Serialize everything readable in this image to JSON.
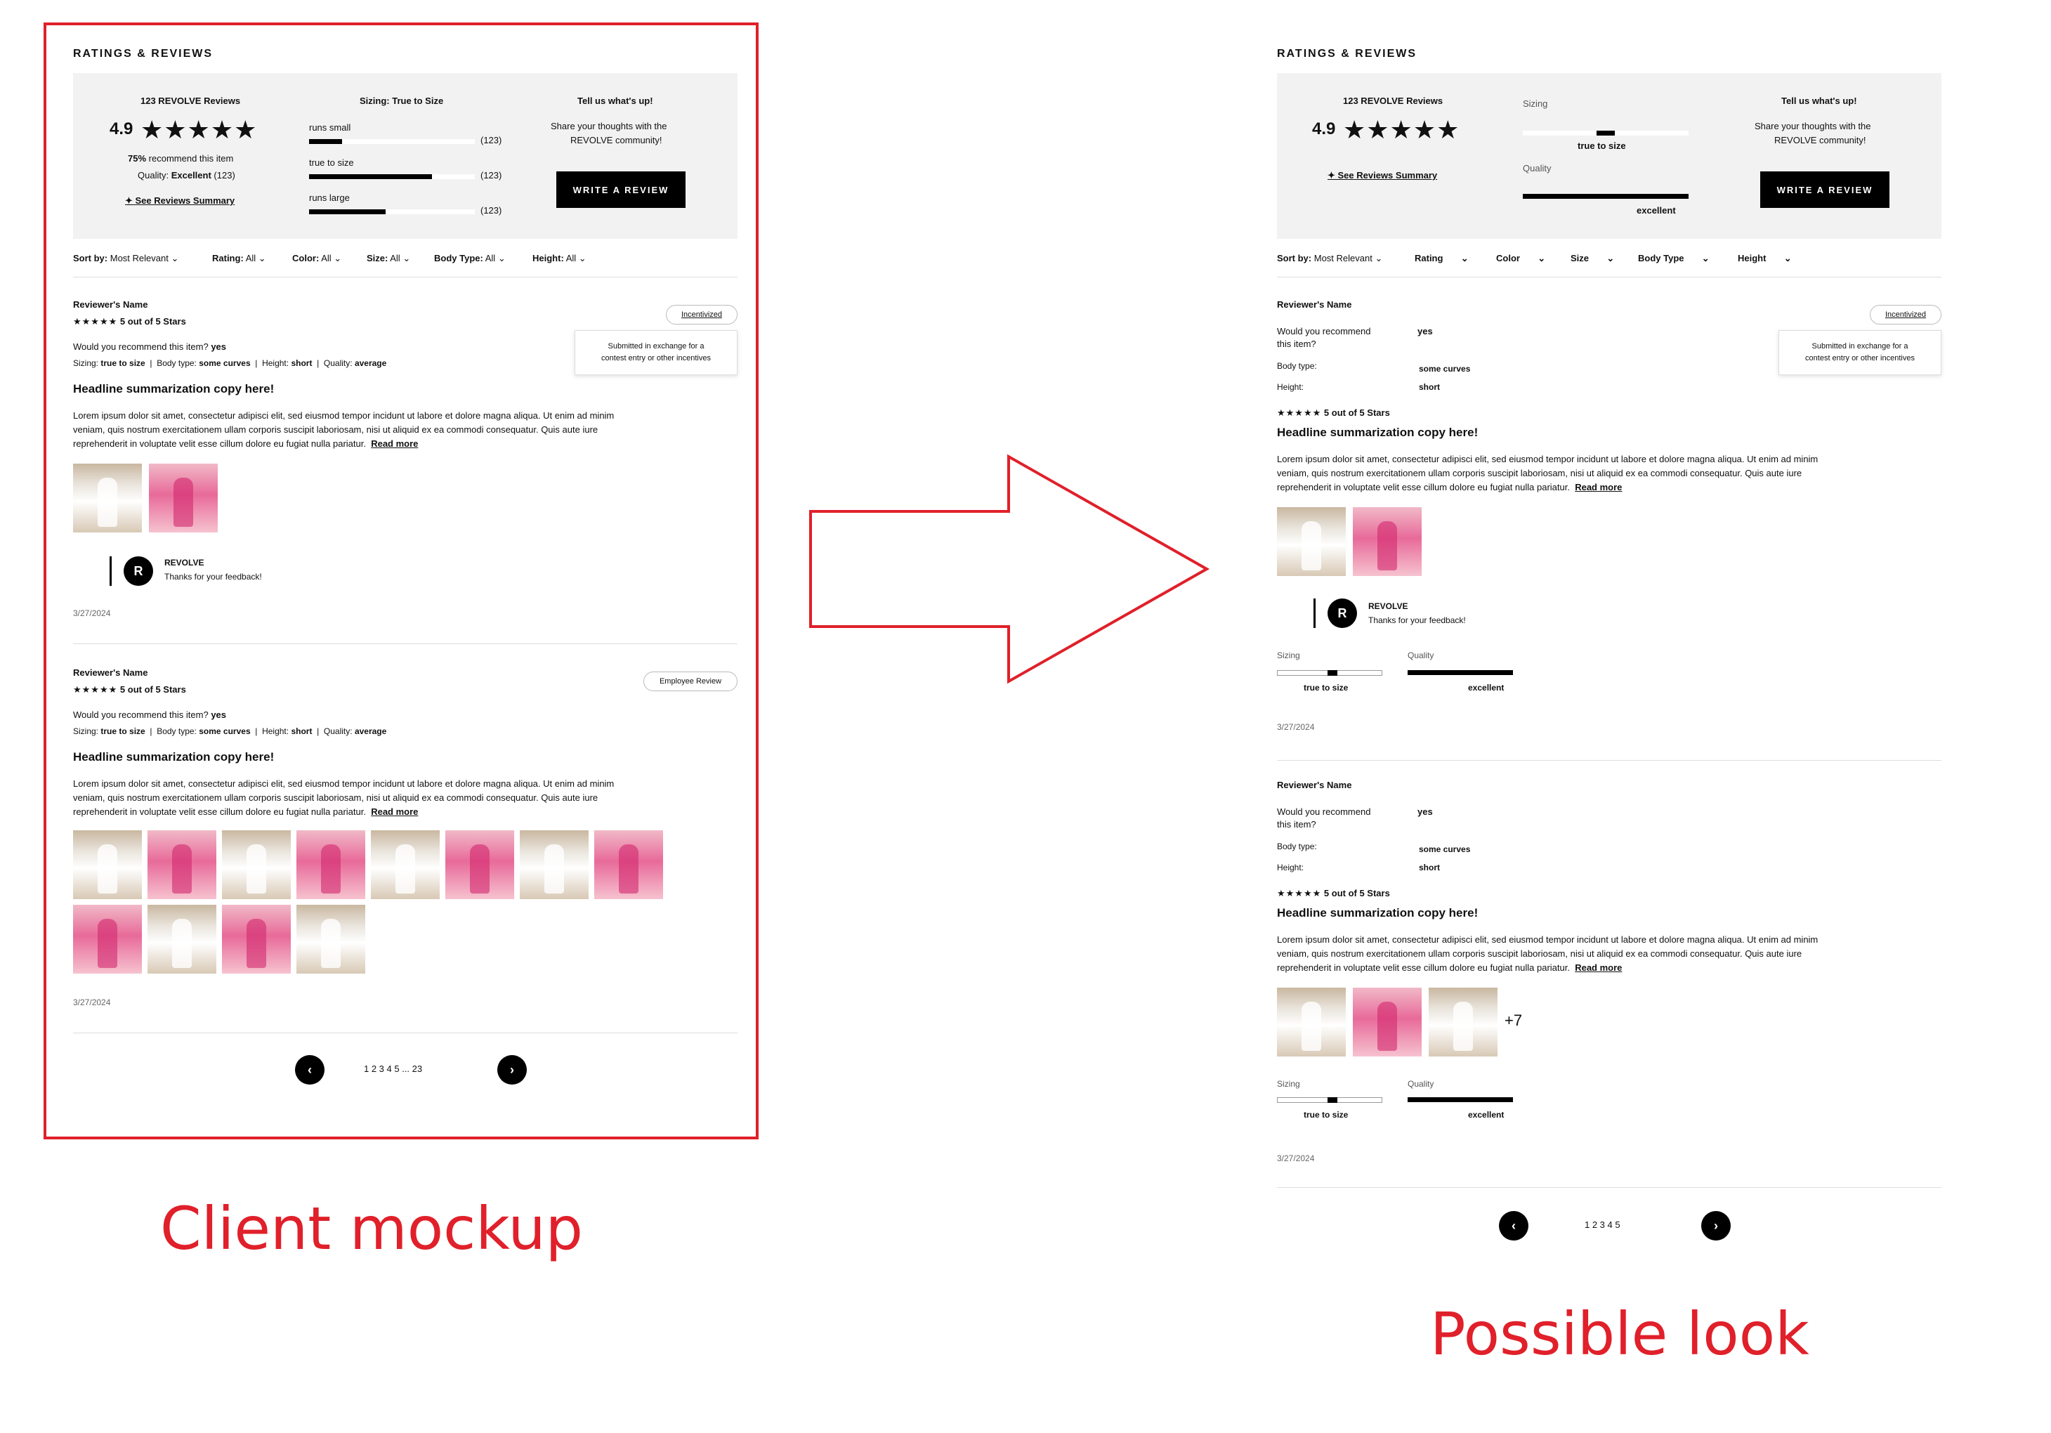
{
  "captions": {
    "left": "Client mockup",
    "right": "Possible look"
  },
  "colors": {
    "accent": "#e0202a",
    "summary_bg": "#f2f2f2",
    "button": "#000000"
  },
  "left": {
    "title": "RATINGS & REVIEWS",
    "summary": {
      "reviews_count": "123 REVOLVE Reviews",
      "rating": "4.9",
      "stars": "★★★★★",
      "recommend_pct": "75%",
      "recommend_text": "recommend this item",
      "quality_label": "Quality:",
      "quality_value": "Excellent",
      "quality_count": "(123)",
      "see_summary": "See Reviews Summary",
      "sizing_title": "Sizing: True to Size",
      "sizing_rows": [
        {
          "label": "runs small",
          "count": "(123)",
          "fill": 0.2
        },
        {
          "label": "true to size",
          "count": "(123)",
          "fill": 0.74
        },
        {
          "label": "runs large",
          "count": "(123)",
          "fill": 0.46
        }
      ],
      "cta_title": "Tell us what's up!",
      "cta_line1": "Share your thoughts with the",
      "cta_line2": "REVOLVE community!",
      "cta_button": "WRITE A REVIEW"
    },
    "filters": {
      "sort_label": "Sort by:",
      "sort_value": "Most Relevant",
      "rating_label": "Rating:",
      "rating_value": "All",
      "color_label": "Color:",
      "color_value": "All",
      "size_label": "Size:",
      "size_value": "All",
      "body_label": "Body Type:",
      "body_value": "All",
      "height_label": "Height:",
      "height_value": "All"
    },
    "reviews": [
      {
        "name": "Reviewer's Name",
        "stars": "★★★★★",
        "stars_text": "5 out of 5 Stars",
        "badge": "Incentivized",
        "tooltip_line1": "Submitted in exchange for a",
        "tooltip_line2": "contest entry or other incentives",
        "recommend_q": "Would you recommend this item?",
        "recommend_a": "yes",
        "sizing_label": "Sizing:",
        "sizing_value": "true to size",
        "body_label": "Body type:",
        "body_value": "some curves",
        "height_label": "Height:",
        "height_value": "short",
        "quality_label": "Quality:",
        "quality_value": "average",
        "headline": "Headline summarization copy here!",
        "body_l1": "Lorem ipsum dolor sit amet, consectetur adipisci elit, sed eiusmod tempor incidunt ut labore et dolore magna aliqua. Ut enim ad minim",
        "body_l2": "veniam, quis nostrum exercitationem ullam corporis suscipit laboriosam, nisi ut aliquid ex ea commodi consequatur. Quis aute iure",
        "body_l3": "reprehenderit in voluptate velit esse cillum dolore eu fugiat nulla pariatur.",
        "read_more": "Read more",
        "brand_initial": "R",
        "brand_name": "REVOLVE",
        "brand_reply": "Thanks for your feedback!",
        "date": "3/27/2024"
      },
      {
        "name": "Reviewer's Name",
        "stars": "★★★★★",
        "stars_text": "5 out of 5 Stars",
        "badge": "Employee Review",
        "recommend_q": "Would you recommend this item?",
        "recommend_a": "yes",
        "sizing_label": "Sizing:",
        "sizing_value": "true to size",
        "body_label": "Body type:",
        "body_value": "some curves",
        "height_label": "Height:",
        "height_value": "short",
        "quality_label": "Quality:",
        "quality_value": "average",
        "headline": "Headline summarization copy here!",
        "body_l1": "Lorem ipsum dolor sit amet, consectetur adipisci elit, sed eiusmod tempor incidunt ut labore et dolore magna aliqua. Ut enim ad minim",
        "body_l2": "veniam, quis nostrum exercitationem ullam corporis suscipit laboriosam, nisi ut aliquid ex ea commodi consequatur. Quis aute iure",
        "body_l3": "reprehenderit in voluptate velit esse cillum dolore eu fugiat nulla pariatur.",
        "read_more": "Read more",
        "date": "3/27/2024"
      }
    ],
    "pagination": {
      "prev": "‹",
      "next": "›",
      "pages": "1 2 3 4 5 ... 23",
      "current": "1"
    }
  },
  "right": {
    "title": "RATINGS & REVIEWS",
    "summary": {
      "reviews_count": "123 REVOLVE Reviews",
      "rating": "4.9",
      "stars": "★★★★★",
      "see_summary": "See Reviews Summary",
      "sizing_label": "Sizing",
      "sizing_value": "true to size",
      "quality_label": "Quality",
      "quality_value": "excellent",
      "cta_title": "Tell us what's up!",
      "cta_line1": "Share your thoughts with the",
      "cta_line2": "REVOLVE community!",
      "cta_button": "WRITE A REVIEW"
    },
    "filters": {
      "sort_label": "Sort by:",
      "sort_value": "Most Relevant",
      "rating": "Rating",
      "color": "Color",
      "size": "Size",
      "body": "Body Type",
      "height": "Height"
    },
    "reviews": [
      {
        "name": "Reviewer's Name",
        "badge": "Incentivized",
        "tooltip_line1": "Submitted in exchange for a",
        "tooltip_line2": "contest entry or other incentives",
        "recommend_q1": "Would you recommend",
        "recommend_q2": "this item?",
        "recommend_a": "yes",
        "body_label": "Body type:",
        "body_value": "some curves",
        "height_label": "Height:",
        "height_value": "short",
        "stars": "★★★★★",
        "stars_text": "5 out of 5 Stars",
        "headline": "Headline summarization copy here!",
        "body_l1": "Lorem ipsum dolor sit amet, consectetur adipisci elit, sed eiusmod tempor incidunt ut labore et dolore magna aliqua. Ut enim ad minim",
        "body_l2": "veniam, quis nostrum exercitationem ullam corporis suscipit laboriosam, nisi ut aliquid ex ea commodi consequatur. Quis aute iure",
        "body_l3": "reprehenderit in voluptate velit esse cillum dolore eu fugiat nulla pariatur.",
        "read_more": "Read more",
        "brand_initial": "R",
        "brand_name": "REVOLVE",
        "brand_reply": "Thanks for your feedback!",
        "sizing_label": "Sizing",
        "sizing_value": "true to size",
        "quality_label": "Quality",
        "quality_value": "excellent",
        "date": "3/27/2024"
      },
      {
        "name": "Reviewer's Name",
        "recommend_q1": "Would you recommend",
        "recommend_q2": "this item?",
        "recommend_a": "yes",
        "body_label": "Body type:",
        "body_value": "some curves",
        "height_label": "Height:",
        "height_value": "short",
        "stars": "★★★★★",
        "stars_text": "5 out of 5 Stars",
        "headline": "Headline summarization copy here!",
        "body_l1": "Lorem ipsum dolor sit amet, consectetur adipisci elit, sed eiusmod tempor incidunt ut labore et dolore magna aliqua. Ut enim ad minim",
        "body_l2": "veniam, quis nostrum exercitationem ullam corporis suscipit laboriosam, nisi ut aliquid ex ea commodi consequatur. Quis aute iure",
        "body_l3": "reprehenderit in voluptate velit esse cillum dolore eu fugiat nulla pariatur.",
        "read_more": "Read more",
        "more_photos": "+7",
        "sizing_label": "Sizing",
        "sizing_value": "true to size",
        "quality_label": "Quality",
        "quality_value": "excellent",
        "date": "3/27/2024"
      }
    ],
    "pagination": {
      "prev": "‹",
      "next": "›",
      "pages": "1 2 3 4 5",
      "current": "1"
    }
  }
}
